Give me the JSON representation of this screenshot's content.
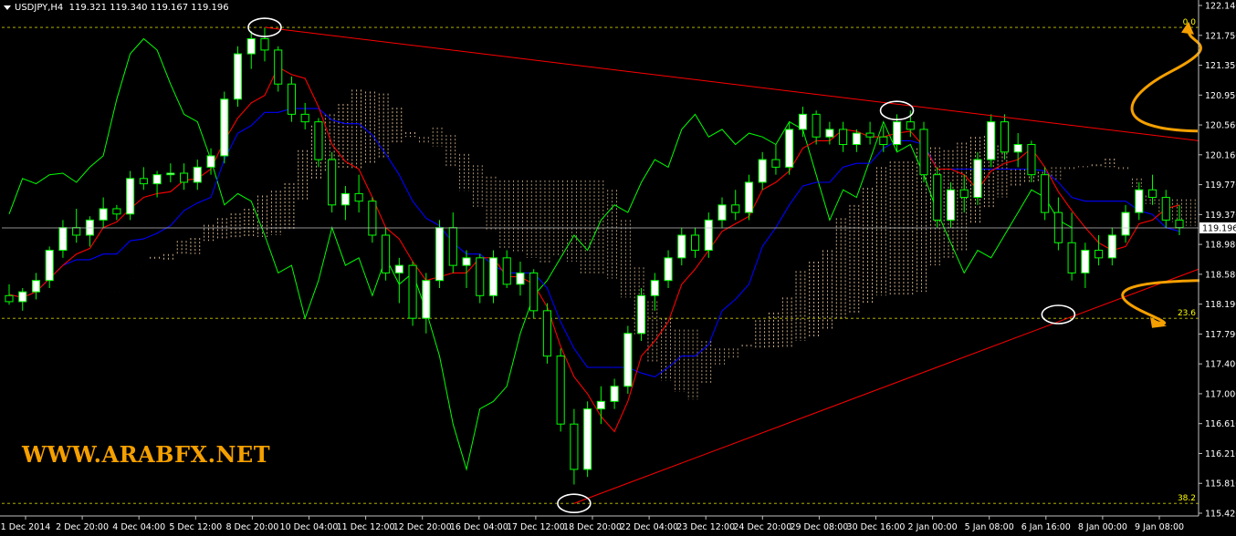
{
  "chart_header": {
    "symbol_tf": "USDJPY,H4",
    "ohlc": "119.321 119.340 119.167 119.196"
  },
  "watermark": "WWW.ARABFX.NET",
  "colors": {
    "background": "#000000",
    "axis": "#c0c0c0",
    "grid_dashed": "#c8c800",
    "bull_candle": "#ffffff",
    "bear_candle": "#000000",
    "wick": "#00ff00",
    "tenkan": "#ff0000",
    "kijun": "#0000ff",
    "chikou": "#00ff00",
    "cloud_a": "#ffd7a8",
    "cloud_b": "#d2b48c",
    "trendline": "#ff0000",
    "fib_text": "#ffff00",
    "arrow": "#f5a000",
    "ellipse": "#ffffff"
  },
  "chart_data": {
    "type": "candlestick",
    "symbol": "USDJPY",
    "timeframe": "H4",
    "current_price": "119.196",
    "y_ticks": [
      "122.140",
      "121.750",
      "121.350",
      "120.950",
      "120.560",
      "120.160",
      "119.770",
      "119.370",
      "118.980",
      "118.580",
      "118.190",
      "117.790",
      "117.400",
      "117.000",
      "116.610",
      "116.210",
      "115.810",
      "115.420"
    ],
    "x_ticks": [
      "1 Dec 2014",
      "2 Dec 20:00",
      "4 Dec 04:00",
      "5 Dec 12:00",
      "8 Dec 20:00",
      "10 Dec 04:00",
      "11 Dec 12:00",
      "12 Dec 20:00",
      "16 Dec 04:00",
      "17 Dec 12:00",
      "18 Dec 20:00",
      "22 Dec 04:00",
      "23 Dec 12:00",
      "24 Dec 20:00",
      "29 Dec 08:00",
      "30 Dec 16:00",
      "2 Jan 00:00",
      "5 Jan 08:00",
      "6 Jan 16:00",
      "8 Jan 00:00",
      "9 Jan 08:00"
    ],
    "fib_levels": [
      {
        "label": "0.0",
        "price": 121.85
      },
      {
        "label": "23.6",
        "price": 118.0
      },
      {
        "label": "38.2",
        "price": 115.55
      }
    ],
    "candles": [
      [
        118.3,
        118.45,
        118.18,
        118.22
      ],
      [
        118.22,
        118.4,
        118.1,
        118.35
      ],
      [
        118.35,
        118.6,
        118.25,
        118.5
      ],
      [
        118.5,
        118.95,
        118.4,
        118.9
      ],
      [
        118.9,
        119.3,
        118.8,
        119.2
      ],
      [
        119.2,
        119.45,
        119.0,
        119.1
      ],
      [
        119.1,
        119.35,
        118.95,
        119.3
      ],
      [
        119.3,
        119.6,
        119.2,
        119.45
      ],
      [
        119.45,
        119.5,
        119.3,
        119.38
      ],
      [
        119.38,
        119.95,
        119.3,
        119.85
      ],
      [
        119.85,
        120.0,
        119.7,
        119.78
      ],
      [
        119.78,
        119.95,
        119.6,
        119.9
      ],
      [
        119.9,
        120.05,
        119.8,
        119.92
      ],
      [
        119.92,
        120.05,
        119.7,
        119.8
      ],
      [
        119.8,
        120.1,
        119.7,
        120.0
      ],
      [
        120.0,
        120.25,
        119.9,
        120.15
      ],
      [
        120.15,
        121.0,
        120.05,
        120.9
      ],
      [
        120.9,
        121.6,
        120.8,
        121.5
      ],
      [
        121.5,
        121.8,
        121.3,
        121.7
      ],
      [
        121.7,
        121.85,
        121.4,
        121.55
      ],
      [
        121.55,
        121.6,
        121.0,
        121.1
      ],
      [
        121.1,
        121.2,
        120.6,
        120.7
      ],
      [
        120.7,
        120.85,
        120.5,
        120.6
      ],
      [
        120.6,
        120.65,
        120.0,
        120.1
      ],
      [
        120.1,
        120.2,
        119.4,
        119.5
      ],
      [
        119.5,
        119.75,
        119.3,
        119.65
      ],
      [
        119.65,
        119.9,
        119.4,
        119.55
      ],
      [
        119.55,
        119.6,
        119.0,
        119.1
      ],
      [
        119.1,
        119.2,
        118.5,
        118.6
      ],
      [
        118.6,
        118.8,
        118.2,
        118.7
      ],
      [
        118.7,
        118.75,
        117.9,
        118.0
      ],
      [
        118.0,
        118.6,
        117.8,
        118.5
      ],
      [
        118.5,
        119.3,
        118.4,
        119.2
      ],
      [
        119.2,
        119.4,
        118.6,
        118.7
      ],
      [
        118.7,
        118.9,
        118.4,
        118.8
      ],
      [
        118.8,
        118.85,
        118.2,
        118.3
      ],
      [
        118.3,
        118.9,
        118.2,
        118.8
      ],
      [
        118.8,
        118.9,
        118.4,
        118.45
      ],
      [
        118.45,
        118.75,
        118.3,
        118.6
      ],
      [
        118.6,
        118.65,
        118.0,
        118.1
      ],
      [
        118.1,
        118.2,
        117.4,
        117.5
      ],
      [
        117.5,
        117.6,
        116.5,
        116.6
      ],
      [
        116.6,
        116.8,
        115.8,
        116.0
      ],
      [
        116.0,
        116.9,
        115.9,
        116.8
      ],
      [
        116.8,
        117.1,
        116.6,
        116.9
      ],
      [
        116.9,
        117.2,
        116.8,
        117.1
      ],
      [
        117.1,
        117.9,
        117.0,
        117.8
      ],
      [
        117.8,
        118.4,
        117.7,
        118.3
      ],
      [
        118.3,
        118.6,
        118.1,
        118.5
      ],
      [
        118.5,
        118.9,
        118.4,
        118.8
      ],
      [
        118.8,
        119.2,
        118.7,
        119.1
      ],
      [
        119.1,
        119.2,
        118.8,
        118.9
      ],
      [
        118.9,
        119.4,
        118.8,
        119.3
      ],
      [
        119.3,
        119.6,
        119.2,
        119.5
      ],
      [
        119.5,
        119.7,
        119.3,
        119.4
      ],
      [
        119.4,
        119.9,
        119.3,
        119.8
      ],
      [
        119.8,
        120.2,
        119.7,
        120.1
      ],
      [
        120.1,
        120.3,
        119.9,
        120.0
      ],
      [
        120.0,
        120.6,
        119.9,
        120.5
      ],
      [
        120.5,
        120.8,
        120.4,
        120.7
      ],
      [
        120.7,
        120.75,
        120.3,
        120.4
      ],
      [
        120.4,
        120.6,
        120.3,
        120.5
      ],
      [
        120.5,
        120.6,
        120.2,
        120.3
      ],
      [
        120.3,
        120.5,
        120.2,
        120.45
      ],
      [
        120.45,
        120.6,
        120.3,
        120.4
      ],
      [
        120.4,
        120.55,
        120.2,
        120.3
      ],
      [
        120.3,
        120.7,
        120.2,
        120.6
      ],
      [
        120.6,
        120.75,
        120.4,
        120.5
      ],
      [
        120.5,
        120.6,
        119.8,
        119.9
      ],
      [
        119.9,
        120.0,
        119.2,
        119.3
      ],
      [
        119.3,
        119.8,
        119.2,
        119.7
      ],
      [
        119.7,
        119.9,
        119.4,
        119.6
      ],
      [
        119.6,
        120.2,
        119.5,
        120.1
      ],
      [
        120.1,
        120.7,
        120.0,
        120.6
      ],
      [
        120.6,
        120.7,
        120.1,
        120.2
      ],
      [
        120.2,
        120.45,
        120.0,
        120.3
      ],
      [
        120.3,
        120.35,
        119.8,
        119.9
      ],
      [
        119.9,
        120.0,
        119.3,
        119.4
      ],
      [
        119.4,
        119.6,
        118.9,
        119.0
      ],
      [
        119.0,
        119.4,
        118.5,
        118.6
      ],
      [
        118.6,
        119.0,
        118.4,
        118.9
      ],
      [
        118.9,
        119.1,
        118.7,
        118.8
      ],
      [
        118.8,
        119.2,
        118.7,
        119.1
      ],
      [
        119.1,
        119.5,
        119.0,
        119.4
      ],
      [
        119.4,
        119.8,
        119.3,
        119.7
      ],
      [
        119.7,
        119.9,
        119.5,
        119.6
      ],
      [
        119.6,
        119.7,
        119.2,
        119.3
      ],
      [
        119.3,
        119.5,
        119.1,
        119.2
      ]
    ]
  }
}
